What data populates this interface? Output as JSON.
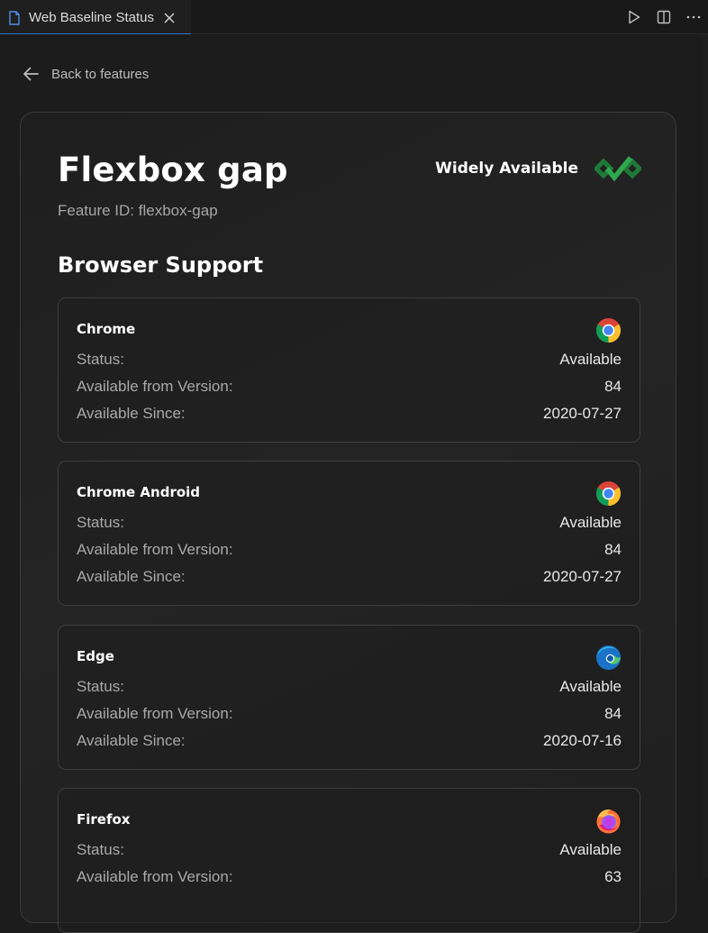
{
  "tab": {
    "title": "Web Baseline Status"
  },
  "nav": {
    "back_label": "Back to features"
  },
  "feature": {
    "name": "Flexbox gap",
    "id_text": "Feature ID: flexbox-gap",
    "baseline_label": "Widely Available",
    "baseline_color": "#2fa84f"
  },
  "support": {
    "heading": "Browser Support",
    "labels": {
      "status": "Status:",
      "version": "Available from Version:",
      "since": "Available Since:"
    },
    "browsers": [
      {
        "name": "Chrome",
        "icon": "chrome-icon",
        "status": "Available",
        "version": "84",
        "since": "2020-07-27"
      },
      {
        "name": "Chrome Android",
        "icon": "chrome-icon",
        "status": "Available",
        "version": "84",
        "since": "2020-07-27"
      },
      {
        "name": "Edge",
        "icon": "edge-icon",
        "status": "Available",
        "version": "84",
        "since": "2020-07-16"
      },
      {
        "name": "Firefox",
        "icon": "firefox-icon",
        "status": "Available",
        "version": "63",
        "since": ""
      }
    ]
  }
}
